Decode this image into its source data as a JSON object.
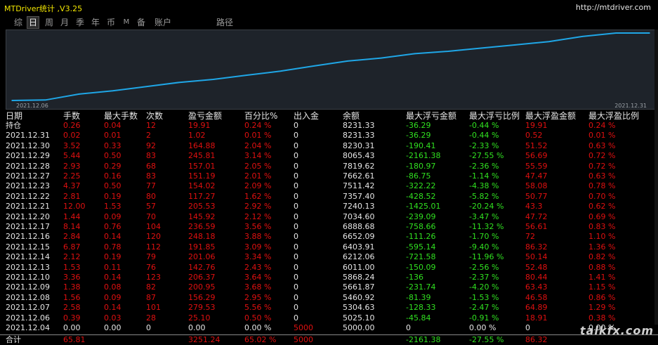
{
  "app_title": "MTDriver统计 ,V3.25",
  "url": "http://mtdriver.com",
  "tabs": [
    "综",
    "日",
    "周",
    "月",
    "季",
    "年",
    "币",
    "M",
    "备",
    "账户",
    "路径"
  ],
  "active_tab": "日",
  "chart": {
    "start_label": "2021.12.06",
    "end_label": "2021.12.31",
    "line_color": "#1fa6e6"
  },
  "chart_data": {
    "type": "line",
    "x": [
      "2021.12.04",
      "2021.12.06",
      "2021.12.07",
      "2021.12.08",
      "2021.12.09",
      "2021.12.10",
      "2021.12.13",
      "2021.12.14",
      "2021.12.15",
      "2021.12.16",
      "2021.12.17",
      "2021.12.20",
      "2021.12.21",
      "2021.12.22",
      "2021.12.23",
      "2021.12.27",
      "2021.12.28",
      "2021.12.29",
      "2021.12.30",
      "2021.12.31"
    ],
    "values": [
      5000.0,
      5025.1,
      5304.63,
      5460.92,
      5661.87,
      5868.24,
      6011.0,
      6212.06,
      6403.91,
      6652.09,
      6888.68,
      7034.6,
      7240.13,
      7357.4,
      7511.42,
      7662.61,
      7819.62,
      8065.43,
      8230.31,
      8231.33
    ],
    "xlabel": "",
    "ylabel": ""
  },
  "headers": [
    "日期",
    "手数",
    "最大手数",
    "次数",
    "盈亏金额",
    "百分比%",
    "出入金",
    "余额",
    "最大浮亏金额",
    "最大浮亏比例",
    "最大浮盈金额",
    "最大浮盈比例"
  ],
  "rows": [
    {
      "date": "持仓",
      "lots": "0.26",
      "max_lots": "0.04",
      "count": "12",
      "pnl": "19.91",
      "pct": "0.24 %",
      "io": "0",
      "bal": "8231.33",
      "max_dd": "-36.29",
      "max_dd_pct": "-0.44 %",
      "max_fp": "19.91",
      "max_fp_pct": "0.24 %"
    },
    {
      "date": "2021.12.31",
      "lots": "0.02",
      "max_lots": "0.01",
      "count": "2",
      "pnl": "1.02",
      "pct": "0.01 %",
      "io": "0",
      "bal": "8231.33",
      "max_dd": "-36.29",
      "max_dd_pct": "-0.44 %",
      "max_fp": "0.52",
      "max_fp_pct": "0.01 %"
    },
    {
      "date": "2021.12.30",
      "lots": "3.52",
      "max_lots": "0.33",
      "count": "92",
      "pnl": "164.88",
      "pct": "2.04 %",
      "io": "0",
      "bal": "8230.31",
      "max_dd": "-190.41",
      "max_dd_pct": "-2.33 %",
      "max_fp": "51.52",
      "max_fp_pct": "0.63 %"
    },
    {
      "date": "2021.12.29",
      "lots": "5.44",
      "max_lots": "0.50",
      "count": "83",
      "pnl": "245.81",
      "pct": "3.14 %",
      "io": "0",
      "bal": "8065.43",
      "max_dd": "-2161.38",
      "max_dd_pct": "-27.55 %",
      "max_fp": "56.69",
      "max_fp_pct": "0.72 %"
    },
    {
      "date": "2021.12.28",
      "lots": "2.93",
      "max_lots": "0.29",
      "count": "68",
      "pnl": "157.01",
      "pct": "2.05 %",
      "io": "0",
      "bal": "7819.62",
      "max_dd": "-180.97",
      "max_dd_pct": "-2.36 %",
      "max_fp": "55.59",
      "max_fp_pct": "0.72 %"
    },
    {
      "date": "2021.12.27",
      "lots": "2.25",
      "max_lots": "0.16",
      "count": "83",
      "pnl": "151.19",
      "pct": "2.01 %",
      "io": "0",
      "bal": "7662.61",
      "max_dd": "-86.75",
      "max_dd_pct": "-1.14 %",
      "max_fp": "47.47",
      "max_fp_pct": "0.63 %"
    },
    {
      "date": "2021.12.23",
      "lots": "4.37",
      "max_lots": "0.50",
      "count": "77",
      "pnl": "154.02",
      "pct": "2.09 %",
      "io": "0",
      "bal": "7511.42",
      "max_dd": "-322.22",
      "max_dd_pct": "-4.38 %",
      "max_fp": "58.08",
      "max_fp_pct": "0.78 %"
    },
    {
      "date": "2021.12.22",
      "lots": "2.81",
      "max_lots": "0.19",
      "count": "80",
      "pnl": "117.27",
      "pct": "1.62 %",
      "io": "0",
      "bal": "7357.40",
      "max_dd": "-428.52",
      "max_dd_pct": "-5.82 %",
      "max_fp": "50.77",
      "max_fp_pct": "0.70 %"
    },
    {
      "date": "2021.12.21",
      "lots": "12.00",
      "max_lots": "1.53",
      "count": "57",
      "pnl": "205.53",
      "pct": "2.92 %",
      "io": "0",
      "bal": "7240.13",
      "max_dd": "-1425.01",
      "max_dd_pct": "-20.24 %",
      "max_fp": "43.3",
      "max_fp_pct": "0.62 %"
    },
    {
      "date": "2021.12.20",
      "lots": "1.44",
      "max_lots": "0.09",
      "count": "70",
      "pnl": "145.92",
      "pct": "2.12 %",
      "io": "0",
      "bal": "7034.60",
      "max_dd": "-239.09",
      "max_dd_pct": "-3.47 %",
      "max_fp": "47.72",
      "max_fp_pct": "0.69 %"
    },
    {
      "date": "2021.12.17",
      "lots": "8.14",
      "max_lots": "0.76",
      "count": "104",
      "pnl": "236.59",
      "pct": "3.56 %",
      "io": "0",
      "bal": "6888.68",
      "max_dd": "-758.66",
      "max_dd_pct": "-11.32 %",
      "max_fp": "56.61",
      "max_fp_pct": "0.83 %"
    },
    {
      "date": "2021.12.16",
      "lots": "2.84",
      "max_lots": "0.14",
      "count": "120",
      "pnl": "248.18",
      "pct": "3.88 %",
      "io": "0",
      "bal": "6652.09",
      "max_dd": "-111.26",
      "max_dd_pct": "-1.70 %",
      "max_fp": "72",
      "max_fp_pct": "1.10 %"
    },
    {
      "date": "2021.12.15",
      "lots": "6.87",
      "max_lots": "0.78",
      "count": "112",
      "pnl": "191.85",
      "pct": "3.09 %",
      "io": "0",
      "bal": "6403.91",
      "max_dd": "-595.14",
      "max_dd_pct": "-9.40 %",
      "max_fp": "86.32",
      "max_fp_pct": "1.36 %"
    },
    {
      "date": "2021.12.14",
      "lots": "2.12",
      "max_lots": "0.19",
      "count": "79",
      "pnl": "201.06",
      "pct": "3.34 %",
      "io": "0",
      "bal": "6212.06",
      "max_dd": "-721.58",
      "max_dd_pct": "-11.96 %",
      "max_fp": "50.14",
      "max_fp_pct": "0.82 %"
    },
    {
      "date": "2021.12.13",
      "lots": "1.53",
      "max_lots": "0.11",
      "count": "76",
      "pnl": "142.76",
      "pct": "2.43 %",
      "io": "0",
      "bal": "6011.00",
      "max_dd": "-150.09",
      "max_dd_pct": "-2.56 %",
      "max_fp": "52.48",
      "max_fp_pct": "0.88 %"
    },
    {
      "date": "2021.12.10",
      "lots": "3.36",
      "max_lots": "0.14",
      "count": "123",
      "pnl": "206.37",
      "pct": "3.64 %",
      "io": "0",
      "bal": "5868.24",
      "max_dd": "-136",
      "max_dd_pct": "-2.37 %",
      "max_fp": "80.44",
      "max_fp_pct": "1.41 %"
    },
    {
      "date": "2021.12.09",
      "lots": "1.38",
      "max_lots": "0.08",
      "count": "82",
      "pnl": "200.95",
      "pct": "3.68 %",
      "io": "0",
      "bal": "5661.87",
      "max_dd": "-231.74",
      "max_dd_pct": "-4.20 %",
      "max_fp": "63.43",
      "max_fp_pct": "1.15 %"
    },
    {
      "date": "2021.12.08",
      "lots": "1.56",
      "max_lots": "0.09",
      "count": "87",
      "pnl": "156.29",
      "pct": "2.95 %",
      "io": "0",
      "bal": "5460.92",
      "max_dd": "-81.39",
      "max_dd_pct": "-1.53 %",
      "max_fp": "46.58",
      "max_fp_pct": "0.86 %"
    },
    {
      "date": "2021.12.07",
      "lots": "2.58",
      "max_lots": "0.14",
      "count": "101",
      "pnl": "279.53",
      "pct": "5.56 %",
      "io": "0",
      "bal": "5304.63",
      "max_dd": "-128.33",
      "max_dd_pct": "-2.47 %",
      "max_fp": "64.89",
      "max_fp_pct": "1.29 %"
    },
    {
      "date": "2021.12.06",
      "lots": "0.39",
      "max_lots": "0.03",
      "count": "28",
      "pnl": "25.10",
      "pct": "0.50 %",
      "io": "0",
      "bal": "5025.10",
      "max_dd": "-45.84",
      "max_dd_pct": "-0.91 %",
      "max_fp": "18.91",
      "max_fp_pct": "0.38 %"
    },
    {
      "date": "2021.12.04",
      "lots": "0.00",
      "max_lots": "0.00",
      "count": "0",
      "pnl": "0.00",
      "pct": "0.00 %",
      "io": "5000",
      "bal": "5000.00",
      "max_dd": "0",
      "max_dd_pct": "0.00 %",
      "max_fp": "0",
      "max_fp_pct": "0.00 %"
    }
  ],
  "total": {
    "date": "合计",
    "lots": "65.81",
    "max_lots": "",
    "count": "",
    "pnl": "3251.24",
    "pct": "65.02 %",
    "io": "5000",
    "bal": "",
    "max_dd": "-2161.38",
    "max_dd_pct": "-27.55 %",
    "max_fp": "86.32",
    "max_fp_pct": ""
  },
  "watermark": "talkfx.com",
  "colors": {
    "positive": "#e01010",
    "negative": "#30e020",
    "neutral": "#e6e6e6",
    "title": "#f2e600"
  }
}
